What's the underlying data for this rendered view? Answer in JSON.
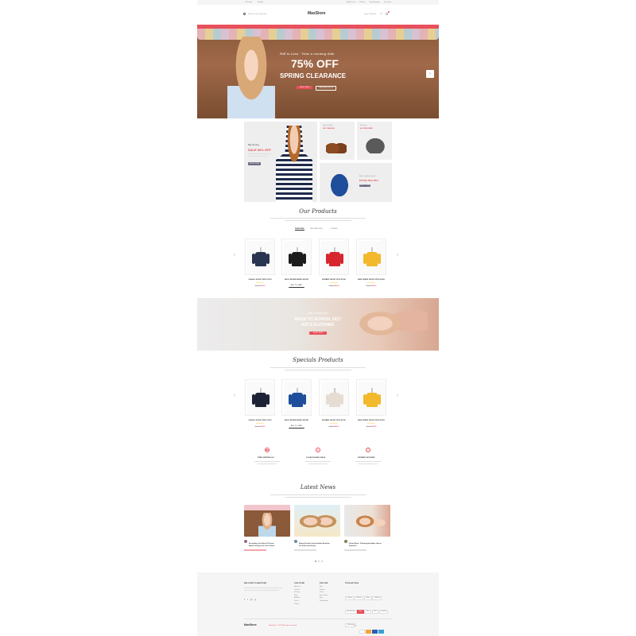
{
  "topbar": {
    "currency": "US Dollar",
    "language": "English",
    "links": [
      "My Account",
      "Wishlist",
      "Login/Register",
      "Checkout"
    ]
  },
  "header": {
    "search_placeholder": "Search entire store here",
    "logo": "MaxStore",
    "login": "Login / Register"
  },
  "nav": [
    "HOME",
    "WOMENS",
    "KIDS COLLECTIONS",
    "SHOPS",
    "BRANDS",
    "DEMOS",
    "BLOG"
  ],
  "hero": {
    "script": "Fall in Love · Time a running Sale",
    "big": "75% OFF",
    "sub": "SPRING CLEARANCE",
    "btn1": "SHOP NOW",
    "btn2": "VIEW PRODUCTS"
  },
  "promo": {
    "big_small": "Big Spring",
    "big_title": "SALE 50% OFF",
    "big_btn": "SHOP NOW",
    "shoes_small": "New & Stock",
    "shoes_title": "HOT FASHION",
    "hat_small": "Hot Item",
    "hat_title": "ACCESSORIES",
    "jacket_small": "Basic Quilted Jacket",
    "jacket_title": "EXTRA 50% OFF",
    "jacket_btn": "SHOP NOW"
  },
  "our_products": {
    "title": "Our Products",
    "tabs": [
      "FEATURED",
      "NEW ARRIVALS",
      "FEMALE"
    ],
    "items": [
      {
        "name": "CASUAL JACKET WITH HOOD",
        "old": "$60.00",
        "price": "$45.00",
        "color": "#2a3550"
      },
      {
        "name": "FAUX LEATHER BIKER JACKET",
        "old": "$60.00",
        "price": "$45.00",
        "color": "#1c1c1c",
        "button": "ADD TO CART"
      },
      {
        "name": "BOMBER JACKET WITH HOOD",
        "old": "$60.00",
        "price": "$45.00",
        "color": "#d7262e"
      },
      {
        "name": "BASIC BIKER JACKET WITH HOOD",
        "old": "$60.00",
        "price": "$45.00",
        "color": "#f1b92b"
      }
    ]
  },
  "school": {
    "script": "Get ready for",
    "title1": "BACK TO SCHOOL 2017",
    "title2": "KID'S CLOTHING",
    "btn": "SHOP NOW"
  },
  "specials": {
    "title": "Specials Products",
    "items": [
      {
        "name": "CASUAL JACKET WITH HOOD",
        "old": "$60.00",
        "price": "$45.00",
        "color": "#1e2236"
      },
      {
        "name": "FAUX LEATHER BIKER JACKET",
        "old": "$60.00",
        "price": "$45.00",
        "color": "#1f4e9a",
        "button": "ADD TO CART"
      },
      {
        "name": "BOMBER JACKET WITH HOOD",
        "old": "$60.00",
        "price": "$45.00",
        "color": "#e6ddd2"
      },
      {
        "name": "BASIC BIKER JACKET WITH HOOD",
        "old": "$60.00",
        "price": "$45.00",
        "color": "#f1b92b"
      }
    ]
  },
  "features": [
    "FREE SHIPPING US",
    "30 DAYS MONEY BACK",
    "PAYMENT SECURED"
  ],
  "news": {
    "title": "Latest News",
    "items": [
      {
        "title": "Everything You Need To Know About Getting Your First Tattoo"
      },
      {
        "title": "Natural Foods show Healthy Benefits For Kids and Family"
      },
      {
        "title": "Social Style: Thanksgiving After-dinner Activities"
      }
    ]
  },
  "footer": {
    "welcome": "WELCOME TO MAXSTORE",
    "store_h": "OUR STORE",
    "store": [
      "About Us",
      "Contact",
      "Sitemap",
      "Blog",
      "Affiliates",
      "Terms",
      "Privacy"
    ],
    "explore_h": "EXPLORE",
    "explore": [
      "Men",
      "Women",
      "Shoes",
      "Accessories",
      "Kids",
      "New Arrivals"
    ],
    "tags_h": "POPULAR TAGS",
    "tags": [
      "Fashion",
      "Women",
      "Shoes",
      "Clothing",
      "Accessories",
      "Men",
      "New",
      "Kids",
      "Summer",
      "Collection"
    ],
    "logo": "MaxStore",
    "copyright": "MaxStore © 2017 All rights reserved",
    "pay": "Pay:"
  },
  "colors": {
    "accent": "#e8505b",
    "dark": "#333333"
  }
}
